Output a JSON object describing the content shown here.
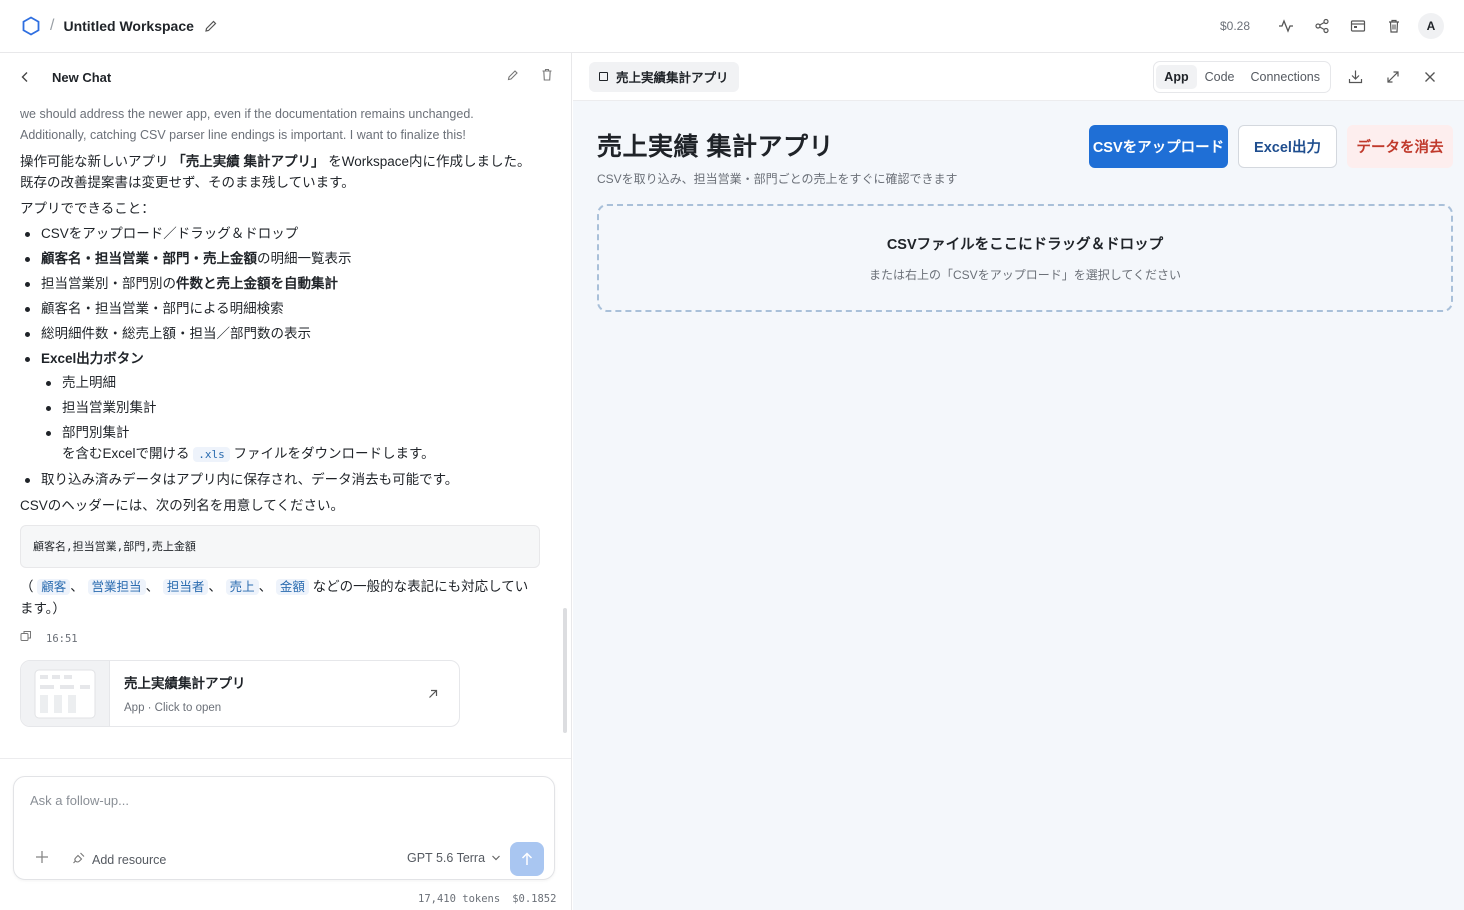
{
  "topbar": {
    "workspace_title": "Untitled Workspace",
    "cost": "$0.28",
    "avatar_initial": "A"
  },
  "chat": {
    "title": "New Chat",
    "faded_text": "we should address the newer app, even if the documentation remains unchanged. Additionally, catching CSV parser line endings is important. I want to finalize this!",
    "p1_pre": "操作可能な新しいアプリ ",
    "p1_bold": "「売上実績 集計アプリ」",
    "p1_post": " をWorkspace内に作成しました。",
    "p1_line2": "既存の改善提案書は変更せず、そのまま残しています。",
    "p2": "アプリでできること：",
    "b1": "CSVをアップロード／ドラッグ＆ドロップ",
    "b2_bold": "顧客名・担当営業・部門・売上金額",
    "b2_rest": "の明細一覧表示",
    "b3_pre": "担当営業別・部門別の",
    "b3_bold": "件数と売上金額を自動集計",
    "b4": "顧客名・担当営業・部門による明細検索",
    "b5": "総明細件数・総売上額・担当／部門数の表示",
    "b6_bold": "Excel出力ボタン",
    "sub1": "売上明細",
    "sub2": "担当営業別集計",
    "sub3": "部門別集計",
    "sub3_cont_pre": "を含むExcelで開ける ",
    "sub3_code": ".xls",
    "sub3_cont_post": " ファイルをダウンロードします。",
    "b7": "取り込み済みデータはアプリ内に保存され、データ消去も可能です。",
    "p3": "CSVのヘッダーには、次の列名を用意してください。",
    "code": "顧客名,担当営業,部門,売上金額",
    "p4_open": "（",
    "chips": [
      "顧客",
      "営業担当",
      "担当者",
      "売上",
      "金額"
    ],
    "sep": "、",
    "p4_close": " などの一般的な表記にも対応しています。）",
    "time": "16:51",
    "card_title": "売上実績集計アプリ",
    "card_sub": "App · Click to open"
  },
  "composer": {
    "placeholder": "Ask a follow-up...",
    "add_resource": "Add resource",
    "model": "GPT 5.6 Terra",
    "tokens": "17,410 tokens",
    "cost": "$0.1852"
  },
  "panel": {
    "tab_label": "売上実績集計アプリ",
    "seg": [
      "App",
      "Code",
      "Connections"
    ]
  },
  "app": {
    "title": "売上実績 集計アプリ",
    "subtitle": "CSVを取り込み、担当営業・部門ごとの売上をすぐに確認できます",
    "upload_button": "CSVをアップロード",
    "excel_button": "Excel出力",
    "clear_button": "データを消去",
    "drop_title": "CSVファイルをここにドラッグ＆ドロップ",
    "drop_sub": "または右上の「CSVをアップロード」を選択してください"
  },
  "colors": {
    "accent": "#1f6fd6",
    "danger": "#c0392b",
    "danger_bg": "#fdeeee",
    "logo": "#2f6fe0"
  }
}
